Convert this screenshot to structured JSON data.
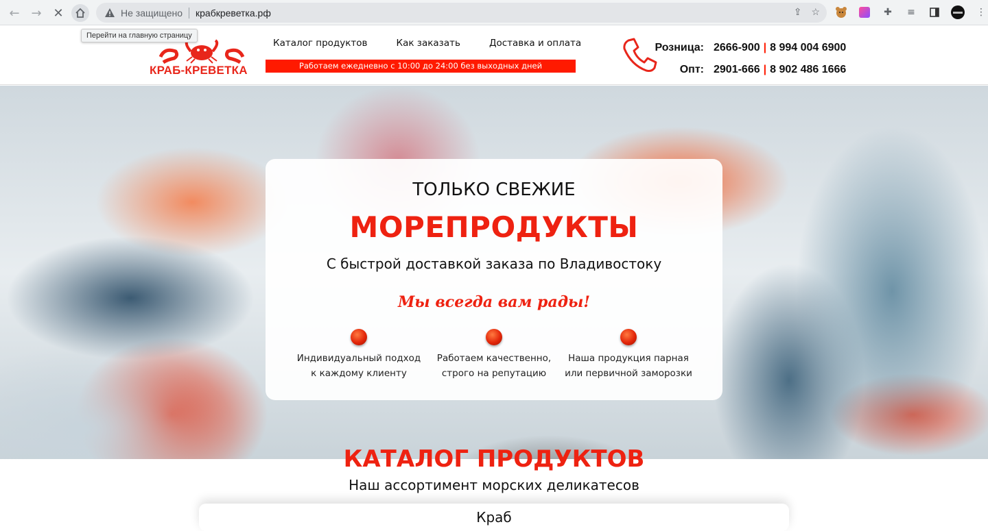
{
  "browser": {
    "security_label": "Не защищено",
    "url": "крабкреветка.рф",
    "home_tooltip": "Перейти на главную страницу"
  },
  "header": {
    "logo_text": "КРАБ-КРЕВЕТКА",
    "menu": [
      {
        "label": "Каталог продуктов"
      },
      {
        "label": "Как заказать"
      },
      {
        "label": "Доставка и оплата"
      }
    ],
    "hours": "Работаем ежедневно с 10:00 до 24:00 без выходных дней",
    "contacts": [
      {
        "label": "Розница:",
        "phone1": "2666-900",
        "phone2": "8 994 004 6900"
      },
      {
        "label": "Опт:",
        "phone1": "2901-666",
        "phone2": "8 902 486 1666"
      }
    ]
  },
  "hero": {
    "subtitle": "ТОЛЬКО СВЕЖИЕ",
    "title": "МОРЕПРОДУКТЫ",
    "description": "С быстрой доставкой заказа по Владивостоку",
    "slogan": "Мы всегда вам рады!",
    "features": [
      {
        "line1": "Индивидуальный подход",
        "line2": "к каждому клиенту"
      },
      {
        "line1": "Работаем качественно,",
        "line2": "строго на репутацию"
      },
      {
        "line1": "Наша продукция парная",
        "line2": "или первичной заморозки"
      }
    ]
  },
  "catalog": {
    "title": "КАТАЛОГ ПРОДУКТОВ",
    "subtitle": "Наш ассортимент морских деликатесов",
    "first_item": "Краб"
  },
  "colors": {
    "accent": "#ee2211",
    "hours_bar": "#ff1a00"
  }
}
